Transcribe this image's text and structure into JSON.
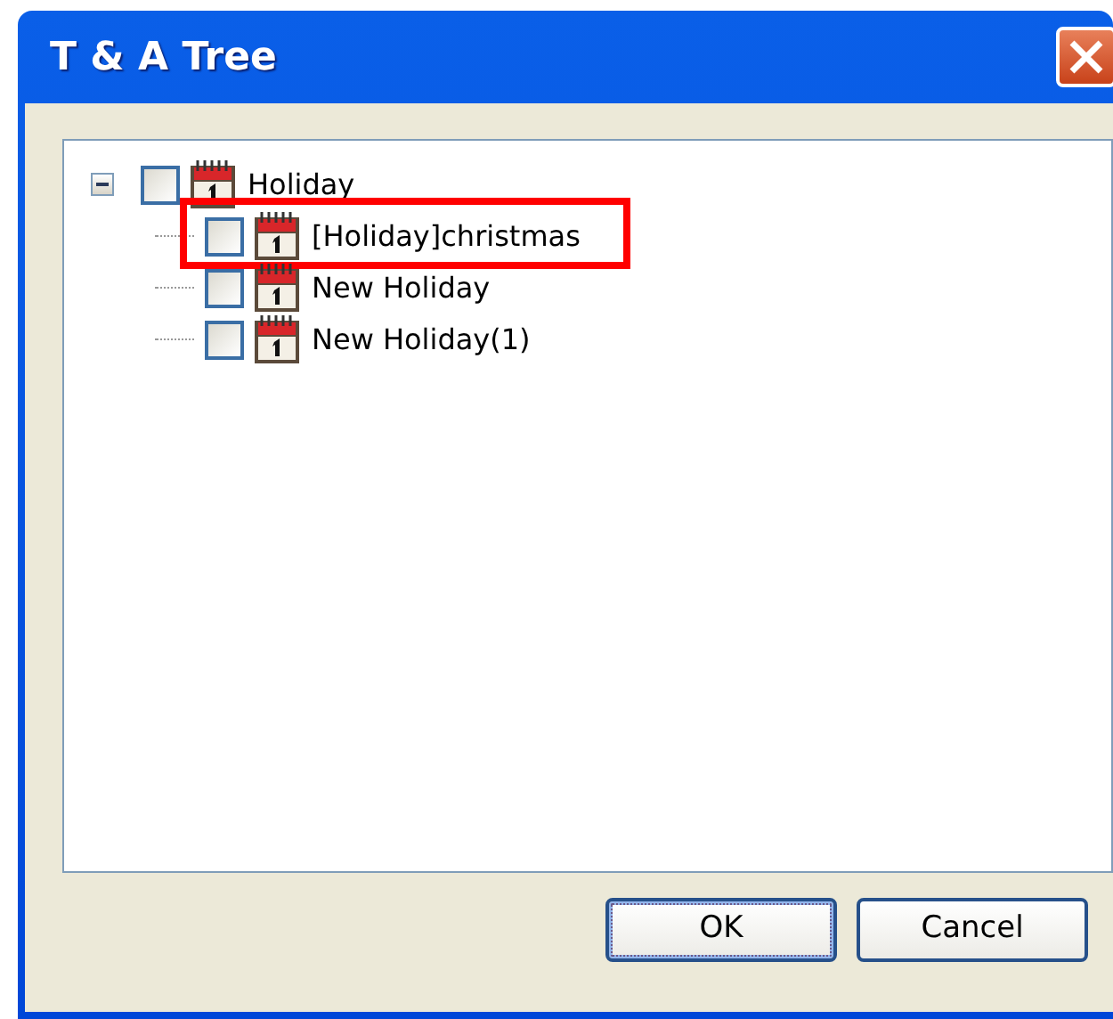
{
  "window": {
    "title": "T & A Tree"
  },
  "tree": [
    {
      "label": "Holiday",
      "checked": false,
      "expanded": true,
      "children": [
        {
          "label": "[Holiday]christmas",
          "checked": false,
          "highlighted": true
        },
        {
          "label": "New Holiday",
          "checked": false,
          "highlighted": false
        },
        {
          "label": "New Holiday(1)",
          "checked": false,
          "highlighted": false
        }
      ]
    }
  ],
  "buttons": [
    {
      "label": "OK",
      "default": true
    },
    {
      "label": "Cancel",
      "default": false
    }
  ]
}
